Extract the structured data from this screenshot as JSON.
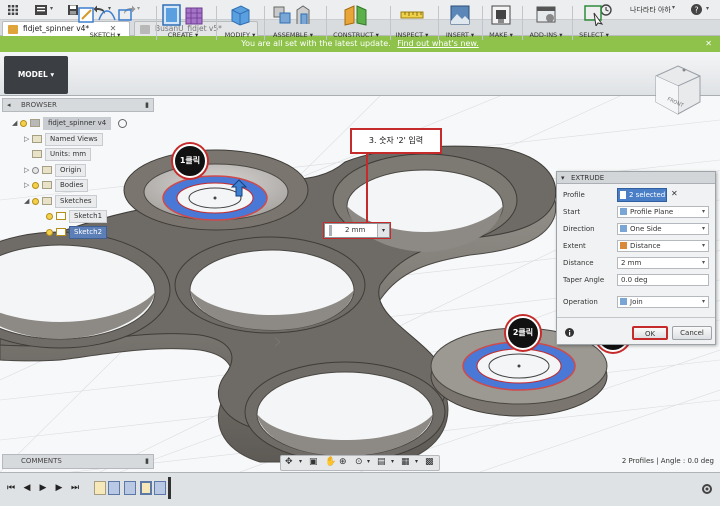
{
  "titlebar": {
    "apps_icon": "grid-icon",
    "file_icon": "file-icon",
    "save_icon": "save-icon",
    "undo_icon": "undo-icon",
    "redo_icon": "redo-icon",
    "user_name": "나다라타 아하",
    "clock_icon": "clock-icon",
    "help_icon": "help-icon"
  },
  "tabs": [
    {
      "label": "fidjet_spinner v4*",
      "active": true
    },
    {
      "label": "BusanU_fidjet v5*",
      "active": false
    }
  ],
  "banner": {
    "text": "You are all set with the latest update.",
    "link": "Find out what's new."
  },
  "toolbar": {
    "workspace": "MODEL",
    "groups": [
      {
        "label": "SKETCH ▾"
      },
      {
        "label": "CREATE ▾"
      },
      {
        "label": "MODIFY ▾"
      },
      {
        "label": "ASSEMBLE ▾"
      },
      {
        "label": "CONSTRUCT ▾"
      },
      {
        "label": "INSPECT ▾"
      },
      {
        "label": "INSERT ▾"
      },
      {
        "label": "MAKE ▾"
      },
      {
        "label": "ADD-INS ▾"
      },
      {
        "label": "SELECT ▾"
      }
    ]
  },
  "viewcube": {
    "label": "FRONT"
  },
  "browser": {
    "title": "BROWSER",
    "root": "fidjet_spinner v4",
    "nodes": [
      {
        "label": "Named Views",
        "indent": 1
      },
      {
        "label": "Units: mm",
        "indent": 1
      },
      {
        "label": "Origin",
        "indent": 1
      },
      {
        "label": "Bodies",
        "indent": 1
      },
      {
        "label": "Sketches",
        "indent": 1
      },
      {
        "label": "Sketch1",
        "indent": 2
      },
      {
        "label": "Sketch2",
        "indent": 2
      }
    ]
  },
  "extrude": {
    "title": "EXTRUDE",
    "rows": [
      {
        "label": "Profile",
        "value": "2 selected"
      },
      {
        "label": "Start",
        "value": "Profile Plane"
      },
      {
        "label": "Direction",
        "value": "One Side"
      },
      {
        "label": "Extent",
        "value": "Distance"
      },
      {
        "label": "Distance",
        "value": "2 mm"
      },
      {
        "label": "Taper Angle",
        "value": "0.0 deg"
      },
      {
        "label": "Operation",
        "value": "Join"
      }
    ],
    "ok_label": "OK",
    "cancel_label": "Cancel",
    "info_icon": "info-icon"
  },
  "distance_input": "2 mm",
  "annotations": {
    "callout": "3. 숫자 '2' 입력",
    "badge1": "1클릭",
    "badge2": "2클릭",
    "badge4": "4클릭"
  },
  "comments": "COMMENTS",
  "status": "2 Profiles | Angle : 0.0 deg",
  "colors": {
    "banner": "#8ec24a",
    "annotation_red": "#c52b2b",
    "selection_blue": "#4a78d6",
    "body_gray": "#8a8680"
  }
}
